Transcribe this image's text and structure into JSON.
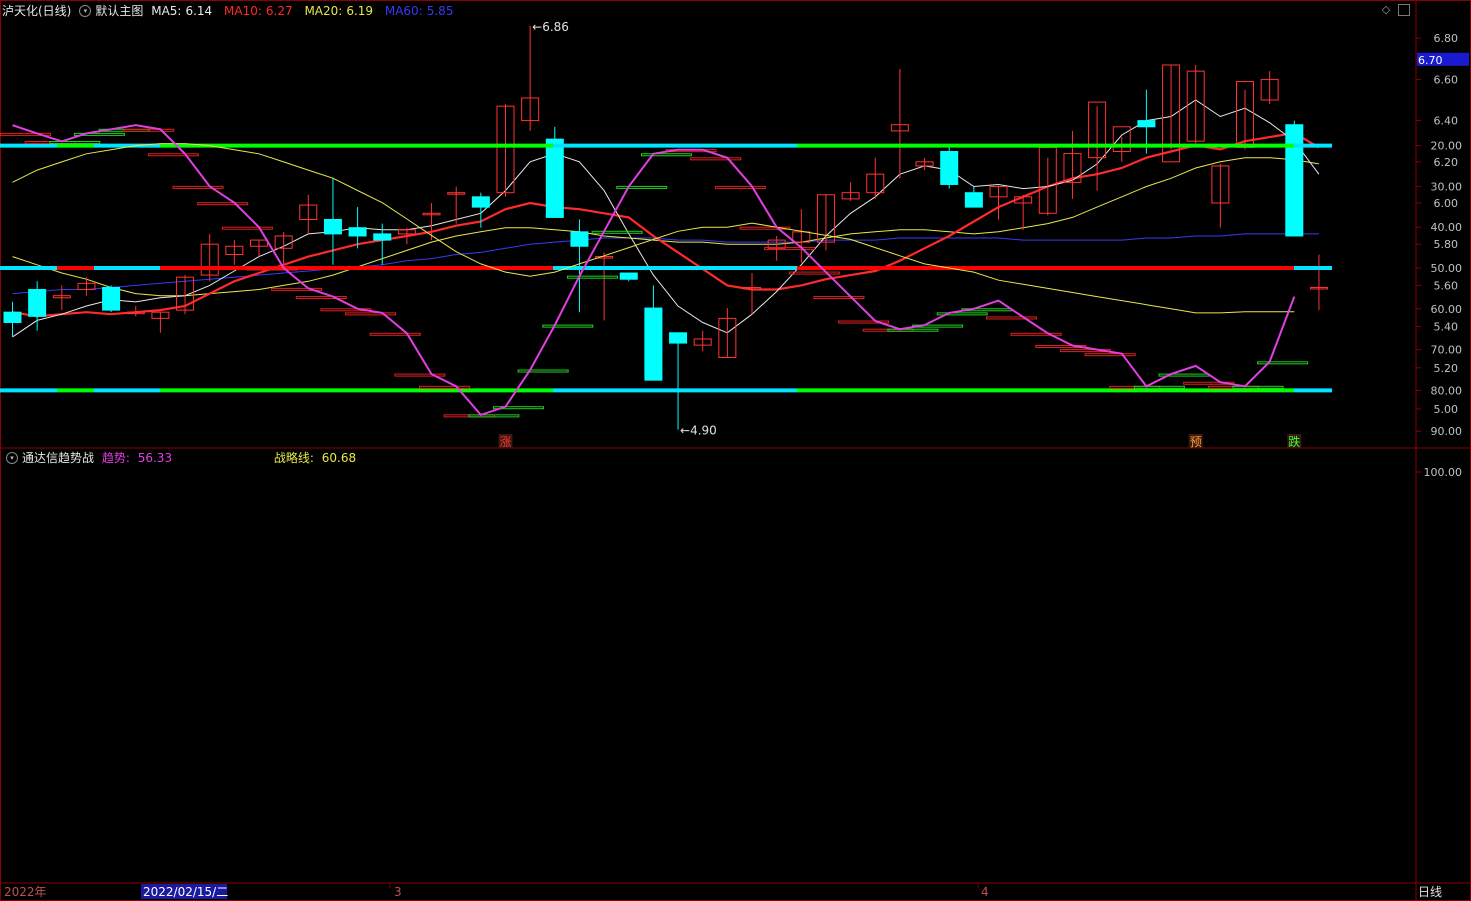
{
  "main_chart": {
    "stock_name": "泸天化(日线)",
    "template": "默认主图",
    "ma5": {
      "label": "MA5:",
      "value": "6.14",
      "color": "#e8e8e8"
    },
    "ma10": {
      "label": "MA10:",
      "value": "6.27",
      "color": "#ff2a2a"
    },
    "ma20": {
      "label": "MA20:",
      "value": "6.19",
      "color": "#e8e84a"
    },
    "ma60": {
      "label": "MA60:",
      "value": "5.85",
      "color": "#3a3af5"
    },
    "current_price": "6.70",
    "high_label": "6.86",
    "low_label": "4.90",
    "y_ticks": [
      "6.80",
      "6.60",
      "6.40",
      "6.20",
      "6.00",
      "5.80",
      "5.60",
      "5.40",
      "5.20",
      "5.00"
    ],
    "signals": [
      {
        "text": "涨",
        "color": "#ff3333"
      },
      {
        "text": "预",
        "color": "#ff9933"
      },
      {
        "text": "跌",
        "color": "#33ff33"
      }
    ]
  },
  "indicator": {
    "name": "通达信趋势战",
    "trend_label": "趋势:",
    "trend_value": "56.33",
    "trend_color": "#e040e0",
    "strategy_label": "战略线:",
    "strategy_value": "60.68",
    "strategy_color": "#e8e84a",
    "y_ticks": [
      "100.00",
      "90.00",
      "80.00",
      "70.00",
      "60.00",
      "50.00",
      "40.00",
      "30.00",
      "20.00"
    ]
  },
  "time_axis": {
    "labels": [
      "2022年",
      "2022/02/15/二",
      "3",
      "4"
    ],
    "period": "日线"
  },
  "colors": {
    "up": "#ff3333",
    "down": "#00ffff",
    "grid_red": "#8b0000"
  },
  "chart_data": {
    "type": "candlestick",
    "ylim": [
      4.8,
      6.9
    ],
    "ohlc": [
      [
        5.47,
        5.52,
        5.35,
        5.42
      ],
      [
        5.58,
        5.62,
        5.38,
        5.45
      ],
      [
        5.54,
        5.6,
        5.48,
        5.55
      ],
      [
        5.58,
        5.64,
        5.55,
        5.61
      ],
      [
        5.59,
        5.6,
        5.47,
        5.48
      ],
      [
        5.47,
        5.5,
        5.45,
        5.47
      ],
      [
        5.44,
        5.47,
        5.37,
        5.47
      ],
      [
        5.48,
        5.65,
        5.46,
        5.64
      ],
      [
        5.65,
        5.85,
        5.62,
        5.8
      ],
      [
        5.75,
        5.82,
        5.7,
        5.79
      ],
      [
        5.79,
        5.82,
        5.74,
        5.82
      ],
      [
        5.78,
        5.86,
        5.7,
        5.84
      ],
      [
        5.92,
        6.04,
        5.85,
        5.99
      ],
      [
        5.92,
        6.12,
        5.7,
        5.85
      ],
      [
        5.88,
        5.98,
        5.78,
        5.84
      ],
      [
        5.85,
        5.9,
        5.7,
        5.82
      ],
      [
        5.85,
        5.88,
        5.8,
        5.87
      ],
      [
        5.95,
        6.0,
        5.82,
        5.95
      ],
      [
        6.05,
        6.08,
        5.9,
        6.05
      ],
      [
        6.03,
        6.05,
        5.88,
        5.98
      ],
      [
        6.05,
        6.48,
        6.03,
        6.47
      ],
      [
        6.4,
        6.86,
        6.35,
        6.51
      ],
      [
        6.31,
        6.37,
        5.94,
        5.93
      ],
      [
        5.86,
        5.92,
        5.47,
        5.79
      ],
      [
        5.74,
        5.76,
        5.43,
        5.74
      ],
      [
        5.66,
        5.63,
        5.62,
        5.63
      ],
      [
        5.49,
        5.6,
        5.16,
        5.14
      ],
      [
        5.37,
        5.32,
        4.9,
        5.32
      ],
      [
        5.31,
        5.38,
        5.28,
        5.34
      ],
      [
        5.25,
        5.49,
        5.25,
        5.44
      ],
      [
        5.59,
        5.66,
        5.46,
        5.59
      ],
      [
        5.78,
        5.84,
        5.72,
        5.82
      ],
      [
        5.81,
        5.97,
        5.71,
        5.86
      ],
      [
        5.81,
        6.04,
        5.77,
        6.04
      ],
      [
        6.02,
        6.1,
        6.01,
        6.05
      ],
      [
        6.05,
        6.22,
        6.02,
        6.14
      ],
      [
        6.35,
        6.65,
        6.12,
        6.38
      ],
      [
        6.18,
        6.22,
        6.16,
        6.2
      ],
      [
        6.25,
        6.28,
        6.07,
        6.09
      ],
      [
        6.05,
        6.08,
        5.99,
        5.98
      ],
      [
        6.03,
        6.08,
        5.92,
        6.08
      ],
      [
        6.0,
        6.04,
        5.87,
        6.03
      ],
      [
        5.95,
        6.22,
        5.94,
        6.27
      ],
      [
        6.1,
        6.35,
        6.02,
        6.24
      ],
      [
        6.22,
        6.47,
        6.06,
        6.49
      ],
      [
        6.25,
        6.32,
        6.2,
        6.37
      ],
      [
        6.4,
        6.55,
        6.24,
        6.37
      ],
      [
        6.2,
        6.67,
        6.26,
        6.67
      ],
      [
        6.3,
        6.67,
        6.29,
        6.64
      ],
      [
        6.0,
        6.19,
        5.88,
        6.18
      ],
      [
        6.27,
        6.55,
        6.26,
        6.59
      ],
      [
        6.5,
        6.64,
        6.48,
        6.6
      ],
      [
        6.38,
        6.4,
        5.84,
        5.84
      ],
      [
        5.59,
        5.75,
        5.48,
        5.59
      ]
    ],
    "ma5": [
      5.35,
      5.43,
      5.46,
      5.5,
      5.53,
      5.52,
      5.54,
      5.55,
      5.6,
      5.67,
      5.74,
      5.79,
      5.85,
      5.86,
      5.88,
      5.87,
      5.87,
      5.89,
      5.92,
      5.95,
      6.06,
      6.2,
      6.24,
      6.2,
      6.06,
      5.85,
      5.65,
      5.5,
      5.42,
      5.37,
      5.46,
      5.57,
      5.7,
      5.84,
      5.95,
      6.03,
      6.14,
      6.18,
      6.16,
      6.08,
      6.09,
      6.07,
      6.08,
      6.11,
      6.19,
      6.33,
      6.4,
      6.42,
      6.5,
      6.42,
      6.46,
      6.39,
      6.3,
      6.14
    ],
    "ma10": [
      5.47,
      5.45,
      5.46,
      5.47,
      5.46,
      5.47,
      5.48,
      5.5,
      5.56,
      5.62,
      5.66,
      5.7,
      5.74,
      5.77,
      5.8,
      5.82,
      5.84,
      5.86,
      5.89,
      5.91,
      5.97,
      6.0,
      5.98,
      5.97,
      5.95,
      5.93,
      5.84,
      5.76,
      5.68,
      5.6,
      5.58,
      5.58,
      5.6,
      5.63,
      5.65,
      5.67,
      5.72,
      5.78,
      5.84,
      5.91,
      5.98,
      6.03,
      6.08,
      6.12,
      6.14,
      6.17,
      6.22,
      6.25,
      6.28,
      6.26,
      6.3,
      6.32,
      6.34,
      6.27
    ],
    "ma20": [
      5.74,
      5.7,
      5.66,
      5.63,
      5.59,
      5.56,
      5.55,
      5.55,
      5.56,
      5.57,
      5.58,
      5.6,
      5.62,
      5.65,
      5.69,
      5.73,
      5.77,
      5.81,
      5.84,
      5.86,
      5.88,
      5.88,
      5.87,
      5.86,
      5.84,
      5.83,
      5.82,
      5.81,
      5.81,
      5.8,
      5.8,
      5.8,
      5.81,
      5.83,
      5.85,
      5.86,
      5.87,
      5.87,
      5.86,
      5.85,
      5.86,
      5.88,
      5.9,
      5.93,
      5.98,
      6.03,
      6.08,
      6.12,
      6.17,
      6.2,
      6.22,
      6.22,
      6.21,
      6.19
    ],
    "ma60": [
      5.56,
      5.57,
      5.58,
      5.58,
      5.59,
      5.6,
      5.61,
      5.62,
      5.63,
      5.64,
      5.65,
      5.66,
      5.67,
      5.68,
      5.69,
      5.7,
      5.72,
      5.73,
      5.75,
      5.76,
      5.78,
      5.8,
      5.81,
      5.82,
      5.83,
      5.83,
      5.83,
      5.82,
      5.82,
      5.81,
      5.81,
      5.81,
      5.81,
      5.82,
      5.82,
      5.82,
      5.83,
      5.83,
      5.83,
      5.83,
      5.83,
      5.82,
      5.82,
      5.82,
      5.82,
      5.82,
      5.83,
      5.83,
      5.84,
      5.84,
      5.85,
      5.85,
      5.85,
      5.85
    ],
    "trend": [
      15,
      17,
      19,
      17,
      16,
      15,
      16,
      22,
      30,
      34,
      40,
      50,
      55,
      57,
      60,
      61,
      66,
      76,
      79,
      86,
      84,
      75,
      64,
      52,
      41,
      30,
      22,
      21,
      21,
      23,
      30,
      40,
      45,
      51,
      57,
      63,
      65,
      64,
      61,
      60,
      58,
      62,
      66,
      69,
      70,
      71,
      79,
      76,
      74,
      78,
      79,
      73,
      57
    ],
    "strategy": [
      29,
      26,
      24,
      22,
      21,
      20,
      19.5,
      19.5,
      20,
      21,
      22,
      24,
      26,
      28,
      31,
      34,
      38,
      42,
      46,
      49,
      51,
      52,
      51,
      49,
      47,
      45,
      43,
      41,
      40,
      40,
      39,
      40,
      41,
      42,
      43,
      45,
      47,
      49,
      50,
      51,
      53,
      54,
      55,
      56,
      57,
      58,
      59,
      60,
      61,
      61,
      60.7,
      60.7,
      60.7
    ],
    "strategy_levels": [
      80,
      50,
      20
    ]
  }
}
